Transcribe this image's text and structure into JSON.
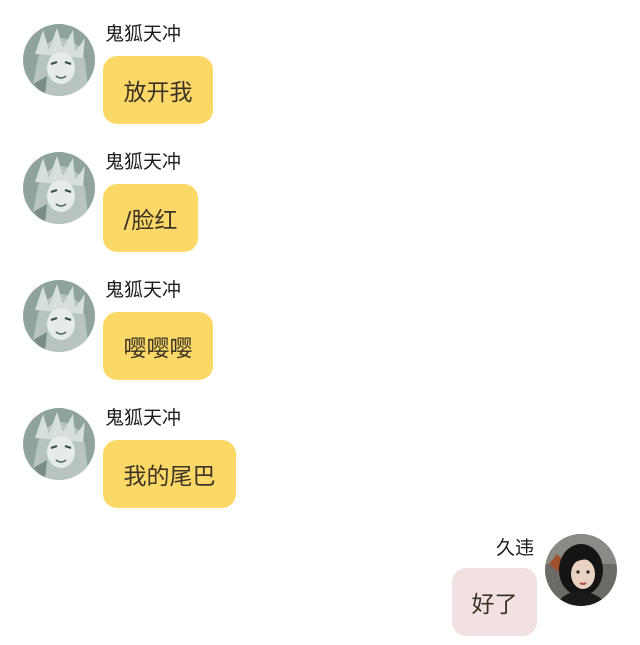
{
  "conversation": {
    "messages": [
      {
        "sender": "鬼狐天冲",
        "text": "放开我",
        "direction": "incoming"
      },
      {
        "sender": "鬼狐天冲",
        "text": "/脸红",
        "direction": "incoming"
      },
      {
        "sender": "鬼狐天冲",
        "text": "嘤嘤嘤",
        "direction": "incoming"
      },
      {
        "sender": "鬼狐天冲",
        "text": "我的尾巴",
        "direction": "incoming"
      },
      {
        "sender": "久违",
        "text": "好了",
        "direction": "outgoing"
      }
    ]
  },
  "colors": {
    "incoming_bubble": "#fcd866",
    "outgoing_bubble": "#f1e2e1",
    "text": "#3b3326"
  },
  "icons": {
    "incoming_avatar": "anime-character-avatar",
    "outgoing_avatar": "photo-woman-avatar"
  }
}
